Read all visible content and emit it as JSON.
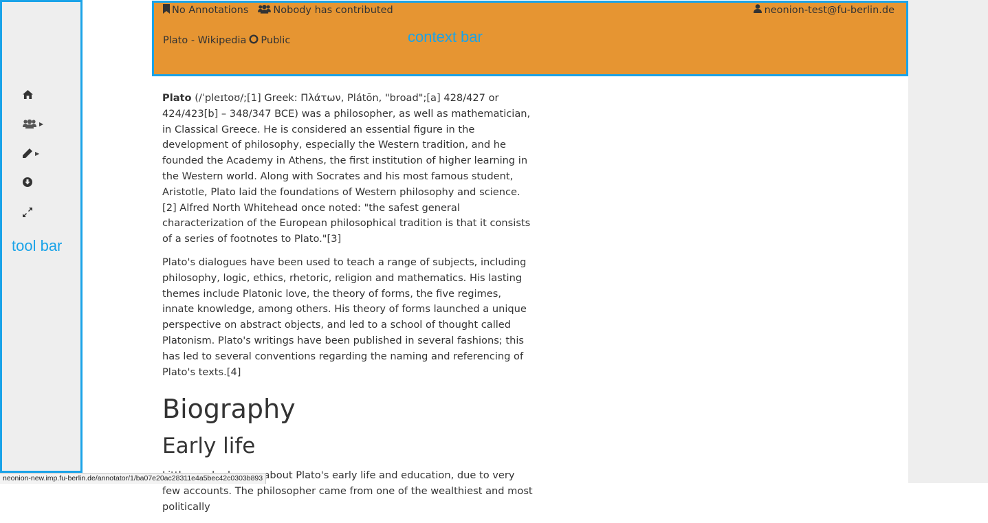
{
  "toolbar": {
    "label": "tool bar",
    "items": [
      {
        "icon": "home-icon"
      },
      {
        "icon": "users-icon",
        "has_caret": true
      },
      {
        "icon": "pencil-icon",
        "has_caret": true
      },
      {
        "icon": "download-icon"
      },
      {
        "icon": "expand-icon"
      }
    ]
  },
  "context_bar": {
    "label": "context bar",
    "annotations": "No Annotations",
    "contributors": "Nobody has contributed",
    "user": "neonion-test@fu-berlin.de",
    "document_title": "Plato - Wikipedia",
    "visibility": "Public",
    "colors": {
      "background": "#e69532",
      "outline": "#1aa3e8"
    }
  },
  "article": {
    "p1_bold": "Plato",
    "p1_rest": " (/ˈpleɪtoʊ/;[1] Greek: Πλάτων, Plátōn, \"broad\";[a] 428/427 or 424/423[b] – 348/347 BCE) was a philosopher, as well as mathematician, in Classical Greece. He is considered an essential figure in the development of philosophy, especially the Western tradition, and he founded the Academy in Athens, the first institution of higher learning in the Western world. Along with Socrates and his most famous student, Aristotle, Plato laid the foundations of Western philosophy and science.[2] Alfred North Whitehead once noted: \"the safest general characterization of the European philosophical tradition is that it consists of a series of footnotes to Plato.\"[3]",
    "p2": "Plato's dialogues have been used to teach a range of subjects, including philosophy, logic, ethics, rhetoric, religion and mathematics. His lasting themes include Platonic love, the theory of forms, the five regimes, innate knowledge, among others. His theory of forms launched a unique perspective on abstract objects, and led to a school of thought called Platonism. Plato's writings have been published in several fashions; this has led to several conventions regarding the naming and referencing of Plato's texts.[4]",
    "h1": "Biography",
    "h2": "Early life",
    "p3": "Little can be known about Plato's early life and education, due to very few accounts. The philosopher came from one of the wealthiest and most politically"
  },
  "status_bar": {
    "url": "neonion-new.imp.fu-berlin.de/annotator/1/ba07e20ac28311e4a5bec42c0303b893"
  }
}
